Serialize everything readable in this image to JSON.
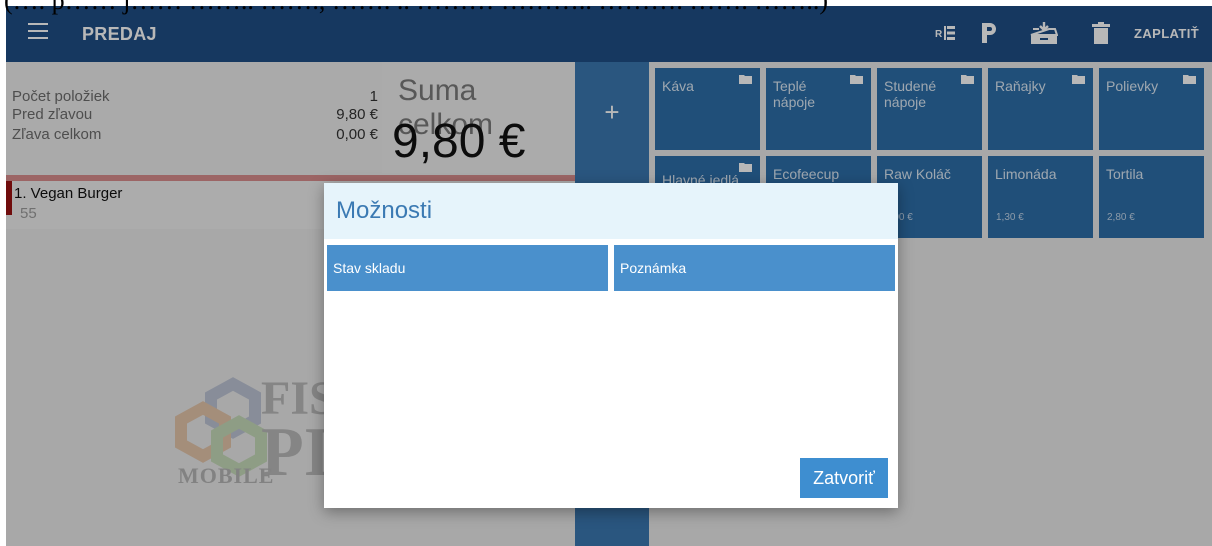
{
  "top_clip_text": "(…. p…… j…… …….. ……., ……. .. ……… ……….. ………. ……. ……..)",
  "topbar": {
    "title": "PREDAJ",
    "pay_label": "ZAPLATIŤ",
    "icons": [
      "menu-icon",
      "split-bill-icon",
      "park-icon",
      "cash-drawer-icon",
      "trash-icon"
    ],
    "background": "#1f4e85"
  },
  "summary": {
    "rows": [
      {
        "label": "Počet položiek",
        "value": "1"
      },
      {
        "label": "Pred zľavou",
        "value": "9,80 €"
      },
      {
        "label": "Zľava celkom",
        "value": "0,00 €"
      }
    ],
    "total_label": "Suma celkom",
    "total_value": "9,80 €"
  },
  "order": {
    "items": [
      {
        "name": "1. Vegan Burger",
        "qty": "55"
      }
    ]
  },
  "plus_label": "+",
  "tiles": [
    {
      "name": "Káva",
      "folder": true,
      "price": ""
    },
    {
      "name": "Teplé nápoje",
      "folder": true,
      "price": ""
    },
    {
      "name": "Studené nápoje",
      "folder": true,
      "price": ""
    },
    {
      "name": "Raňajky",
      "folder": true,
      "price": ""
    },
    {
      "name": "Polievky",
      "folder": true,
      "price": ""
    },
    {
      "name": "Hlavné jedlá",
      "folder": true,
      "price": ""
    },
    {
      "name": "Ecofeecup",
      "folder": false,
      "price": ""
    },
    {
      "name": "Raw Koláč",
      "folder": false,
      "price": "3,00 €"
    },
    {
      "name": "Limonáda",
      "folder": false,
      "price": "1,30 €"
    },
    {
      "name": "Tortila",
      "folder": false,
      "price": "2,80 €"
    }
  ],
  "watermark": {
    "line1": "FIS",
    "line2": "PI",
    "mobile": "MOBILE"
  },
  "dialog": {
    "title": "Možnosti",
    "options": [
      "Stav skladu",
      "Poznámka"
    ],
    "close_label": "Zatvoriť"
  },
  "colors": {
    "accent": "#3b7ab3",
    "tile": "#2d6ea8",
    "button": "#4a90cc",
    "item_marker": "#9b1313"
  }
}
